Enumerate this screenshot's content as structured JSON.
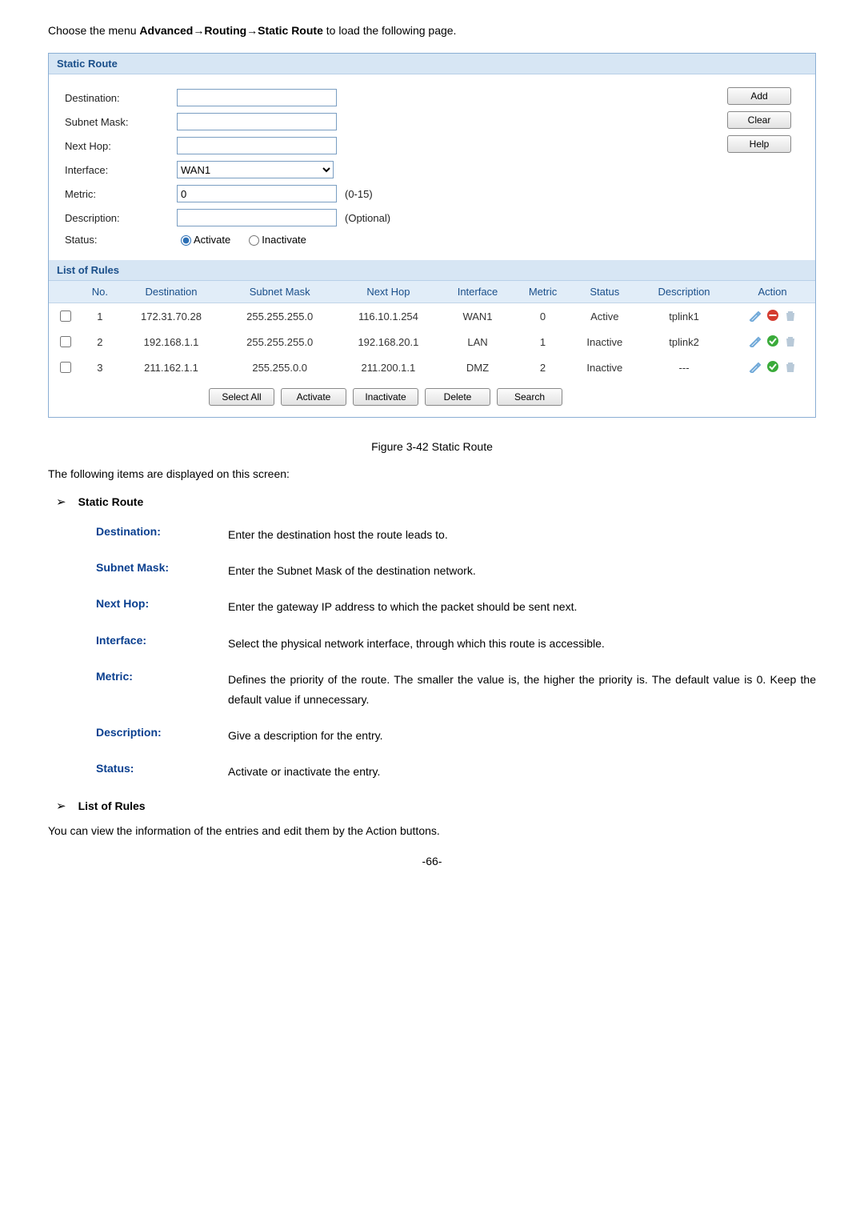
{
  "intro": {
    "prefix": "Choose the menu ",
    "path_bold": "Advanced→Routing→Static Route",
    "suffix": " to load the following page."
  },
  "panel1_title": "Static Route",
  "form": {
    "destination_label": "Destination:",
    "subnet_label": "Subnet Mask:",
    "nexthop_label": "Next Hop:",
    "interface_label": "Interface:",
    "interface_value": "WAN1",
    "metric_label": "Metric:",
    "metric_value": "0",
    "metric_hint": "(0-15)",
    "description_label": "Description:",
    "description_hint": "(Optional)",
    "status_label": "Status:",
    "status_activate": "Activate",
    "status_inactivate": "Inactivate"
  },
  "buttons": {
    "add": "Add",
    "clear": "Clear",
    "help": "Help",
    "select_all": "Select All",
    "activate": "Activate",
    "inactivate": "Inactivate",
    "delete": "Delete",
    "search": "Search"
  },
  "panel2_title": "List of Rules",
  "table": {
    "headers": {
      "no": "No.",
      "destination": "Destination",
      "subnet": "Subnet Mask",
      "nexthop": "Next Hop",
      "interface": "Interface",
      "metric": "Metric",
      "status": "Status",
      "description": "Description",
      "action": "Action"
    },
    "rows": [
      {
        "no": "1",
        "destination": "172.31.70.28",
        "subnet": "255.255.255.0",
        "nexthop": "116.10.1.254",
        "interface": "WAN1",
        "metric": "0",
        "status": "Active",
        "description": "tplink1",
        "action_type": "minus"
      },
      {
        "no": "2",
        "destination": "192.168.1.1",
        "subnet": "255.255.255.0",
        "nexthop": "192.168.20.1",
        "interface": "LAN",
        "metric": "1",
        "status": "Inactive",
        "description": "tplink2",
        "action_type": "check"
      },
      {
        "no": "3",
        "destination": "211.162.1.1",
        "subnet": "255.255.0.0",
        "nexthop": "211.200.1.1",
        "interface": "DMZ",
        "metric": "2",
        "status": "Inactive",
        "description": "---",
        "action_type": "check2"
      }
    ]
  },
  "caption": "Figure 3-42 Static Route",
  "after_caption": "The following items are displayed on this screen:",
  "section1_title": "Static Route",
  "defs": [
    {
      "term": "Destination:",
      "desc": "Enter the destination host the route leads to."
    },
    {
      "term": "Subnet Mask:",
      "desc": "Enter the Subnet Mask of the destination network."
    },
    {
      "term": "Next Hop:",
      "desc": "Enter the gateway IP address to which the packet should be sent next."
    },
    {
      "term": "Interface:",
      "desc": "Select the physical network interface, through which this route is accessible."
    },
    {
      "term": "Metric:",
      "desc": "Defines the priority of the route. The smaller the value is, the higher the priority is. The default value is 0. Keep the default value if unnecessary."
    },
    {
      "term": "Description:",
      "desc": "Give a description for the entry."
    },
    {
      "term": "Status:",
      "desc": "Activate or inactivate the entry."
    }
  ],
  "section2_title": "List of Rules",
  "section2_body": "You can view the information of the entries and edit them by the Action buttons.",
  "page_number": "-66-"
}
